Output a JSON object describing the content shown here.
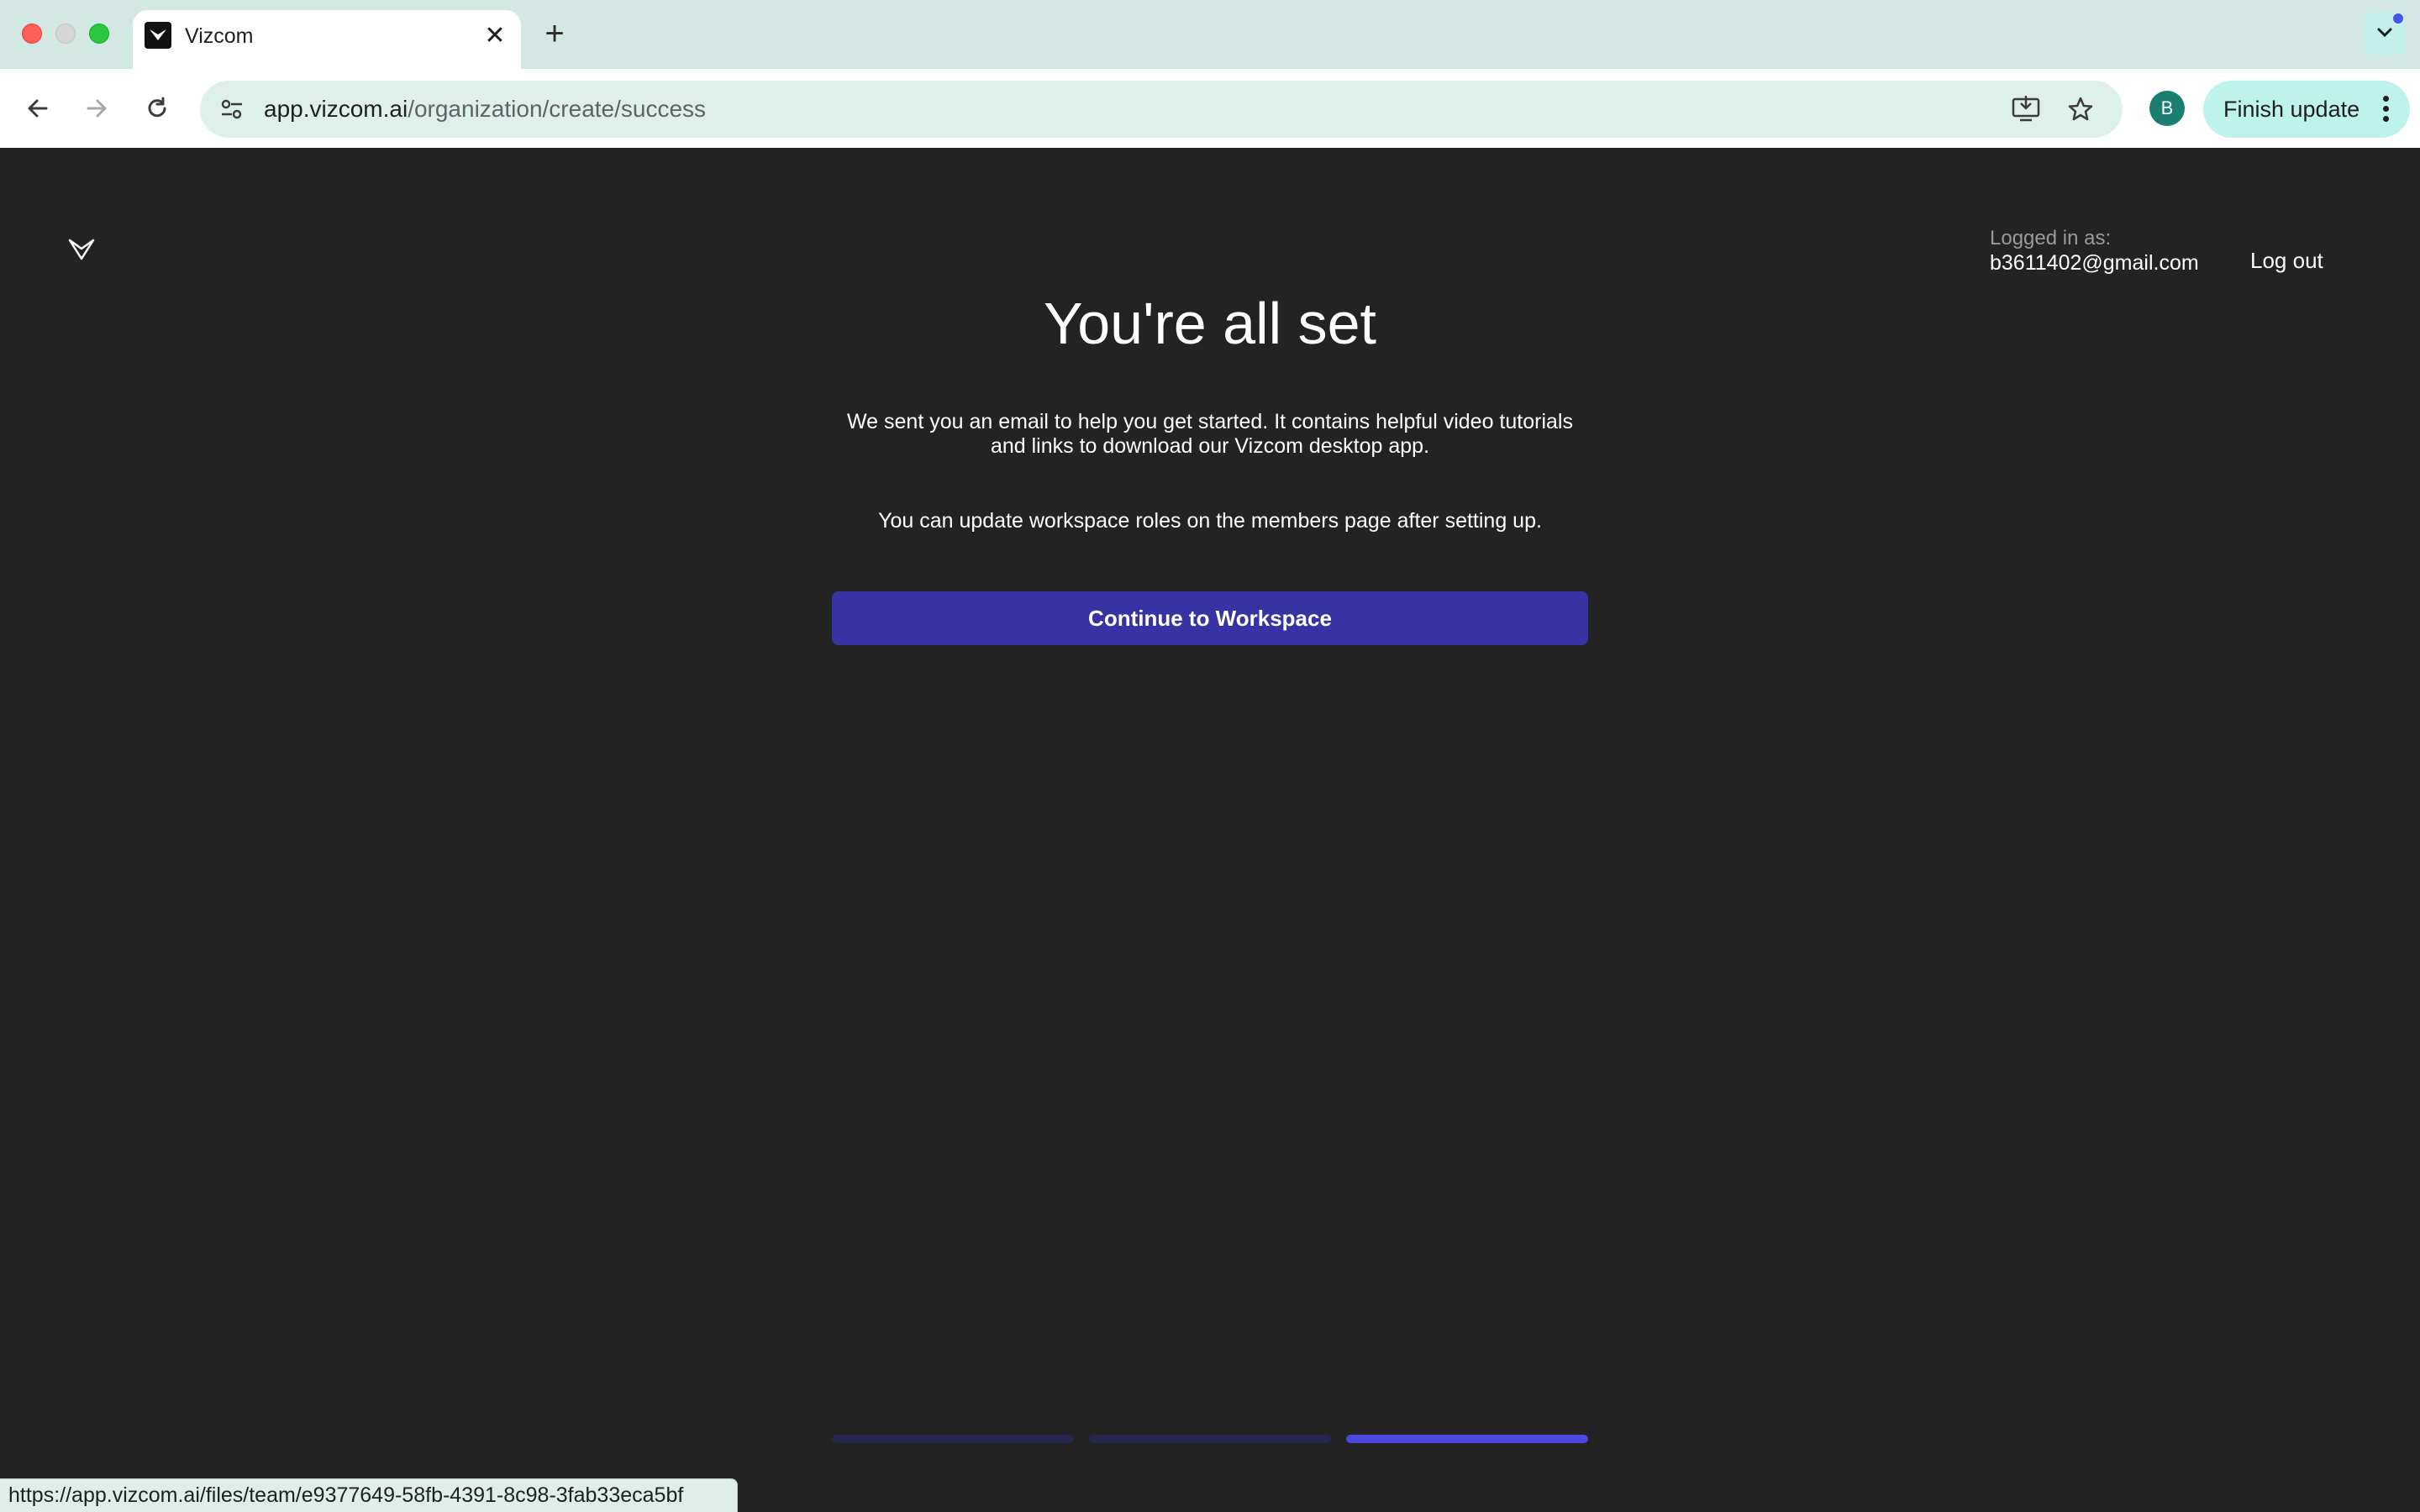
{
  "browser": {
    "tab_title": "Vizcom",
    "new_tab_symbol": "+",
    "tab_close_symbol": "✕",
    "url_host": "app.vizcom.ai",
    "url_path": "/organization/create/success",
    "profile_initial": "B",
    "finish_update_label": "Finish update",
    "status_bar_url": "https://app.vizcom.ai/files/team/e9377649-58fb-4391-8c98-3fab33eca5bf"
  },
  "account": {
    "caption": "Logged in as:",
    "email": "b3611402@gmail.com",
    "logout_label": "Log out"
  },
  "main": {
    "title": "You're all set",
    "paragraph_1_line_1": "We sent you an email to help you get started. It contains helpful video tutorials",
    "paragraph_1_line_2": "and links to download our Vizcom desktop app.",
    "paragraph_2": "You can update workspace roles on the members page after setting up.",
    "continue_button": "Continue to Workspace"
  },
  "progress": {
    "total_steps": 3,
    "current_step": 3
  },
  "colors": {
    "page_background": "#232323",
    "primary_button": "#3634a5",
    "progress_active": "#4b48e0",
    "progress_inactive": "#26264f"
  }
}
